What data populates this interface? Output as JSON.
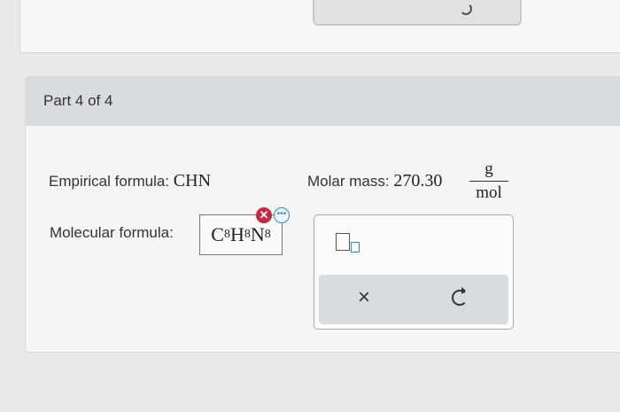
{
  "part": {
    "title": "Part 4 of 4"
  },
  "empirical": {
    "label": "Empirical formula:",
    "value": "CHN"
  },
  "molar_mass": {
    "label": "Molar mass:",
    "value": "270.30",
    "unit_num": "g",
    "unit_den": "mol"
  },
  "molecular": {
    "label": "Molecular formula:",
    "answer": [
      {
        "el": "C",
        "sub": "8"
      },
      {
        "el": "H",
        "sub": "8"
      },
      {
        "el": "N",
        "sub": "8"
      }
    ],
    "status_icon": "x-circle-icon",
    "more_icon": "more-options-icon"
  },
  "toolbar": {
    "superscript_icon": "superscript-template-icon",
    "clear_label": "×",
    "undo_icon": "undo-icon"
  },
  "colors": {
    "error": "#c8283e",
    "accent": "#2f8cc7",
    "header_bg": "#d9dcdf"
  }
}
